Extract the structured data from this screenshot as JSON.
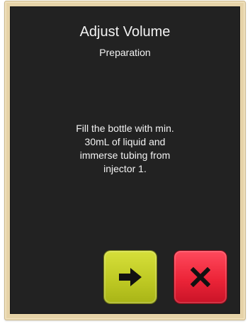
{
  "dialog": {
    "title": "Adjust Volume",
    "subtitle": "Preparation",
    "message_lines": [
      "Fill the bottle with min.",
      "30mL of liquid and",
      "immerse tubing from",
      "injector 1."
    ]
  },
  "buttons": {
    "next": {
      "icon": "arrow-right-icon",
      "color": "#c7d12a"
    },
    "cancel": {
      "icon": "close-icon",
      "color": "#ec2438"
    }
  },
  "colors": {
    "screen_background": "#222222",
    "bezel": "#e6d3a8",
    "text": "#f2f2f2"
  }
}
